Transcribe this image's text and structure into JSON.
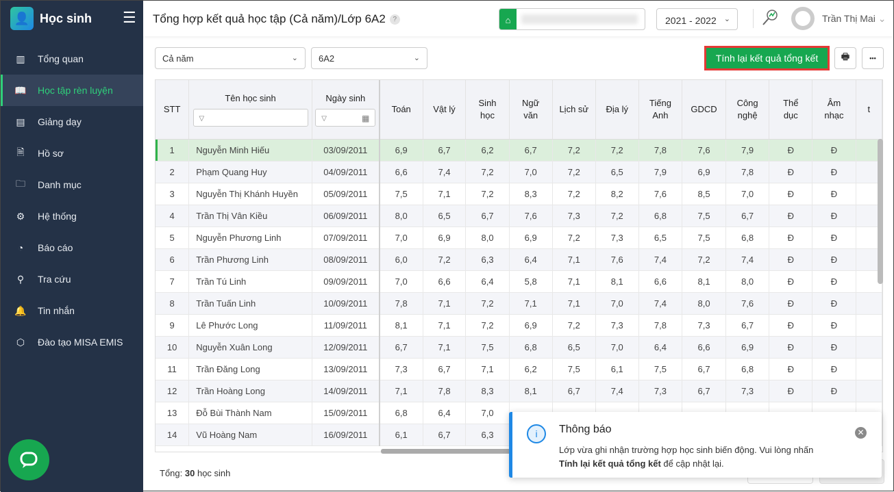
{
  "app": {
    "title": "Học sinh"
  },
  "sidebar": {
    "items": [
      {
        "label": "Tổng quan",
        "icon": "chart-bars-icon"
      },
      {
        "label": "Học tập rèn luyện",
        "icon": "book-icon",
        "active": true
      },
      {
        "label": "Giảng dạy",
        "icon": "board-icon"
      },
      {
        "label": "Hồ sơ",
        "icon": "document-icon"
      },
      {
        "label": "Danh mục",
        "icon": "folder-icon"
      },
      {
        "label": "Hệ thống",
        "icon": "gear-icon"
      },
      {
        "label": "Báo cáo",
        "icon": "pie-chart-icon"
      },
      {
        "label": "Tra cứu",
        "icon": "search-icon"
      },
      {
        "label": "Tin nhắn",
        "icon": "bell-icon"
      },
      {
        "label": "Đào tạo MISA EMIS",
        "icon": "box-icon"
      }
    ]
  },
  "header": {
    "title": "Tổng hợp kết quả học tập (Cả năm)/Lớp 6A2",
    "help": "?",
    "school_year": "2021 - 2022",
    "user": "Trần Thị Mai"
  },
  "toolbar": {
    "period": "Cả năm",
    "class": "6A2",
    "recalc_label": "Tính lại kết quả tổng kết",
    "more": "•••"
  },
  "table": {
    "headers": {
      "stt": "STT",
      "name": "Tên học sinh",
      "dob": "Ngày sinh"
    },
    "subjects": [
      [
        "Toán"
      ],
      [
        "Vật lý"
      ],
      [
        "Sinh",
        "học"
      ],
      [
        "Ngữ",
        "văn"
      ],
      [
        "Lịch sử"
      ],
      [
        "Địa lý"
      ],
      [
        "Tiếng",
        "Anh"
      ],
      [
        "GDCD"
      ],
      [
        "Công",
        "nghệ"
      ],
      [
        "Thể",
        "dục"
      ],
      [
        "Âm",
        "nhạc"
      ],
      [
        "t"
      ]
    ],
    "rows": [
      [
        "1",
        "Nguyễn Minh Hiếu",
        "03/09/2011",
        "6,9",
        "6,7",
        "6,2",
        "6,7",
        "7,2",
        "7,2",
        "7,8",
        "7,6",
        "7,9",
        "Đ",
        "Đ"
      ],
      [
        "2",
        "Phạm Quang Huy",
        "04/09/2011",
        "6,6",
        "7,4",
        "7,2",
        "7,0",
        "7,2",
        "6,5",
        "7,9",
        "6,9",
        "7,8",
        "Đ",
        "Đ"
      ],
      [
        "3",
        "Nguyễn Thị Khánh Huyền",
        "05/09/2011",
        "7,5",
        "7,1",
        "7,2",
        "8,3",
        "7,2",
        "8,2",
        "7,6",
        "8,5",
        "7,0",
        "Đ",
        "Đ"
      ],
      [
        "4",
        "Trần Thị Vân Kiều",
        "06/09/2011",
        "8,0",
        "6,5",
        "6,7",
        "7,6",
        "7,3",
        "7,2",
        "6,8",
        "7,5",
        "6,7",
        "Đ",
        "Đ"
      ],
      [
        "5",
        "Nguyễn Phương Linh",
        "07/09/2011",
        "7,0",
        "6,9",
        "8,0",
        "6,9",
        "7,2",
        "7,3",
        "6,5",
        "7,5",
        "6,8",
        "Đ",
        "Đ"
      ],
      [
        "6",
        "Trần Phương Linh",
        "08/09/2011",
        "6,0",
        "7,2",
        "6,3",
        "6,4",
        "7,1",
        "7,6",
        "7,4",
        "7,2",
        "7,4",
        "Đ",
        "Đ"
      ],
      [
        "7",
        "Trần Tú Linh",
        "09/09/2011",
        "7,0",
        "6,6",
        "6,4",
        "5,8",
        "7,1",
        "8,1",
        "6,6",
        "8,1",
        "8,0",
        "Đ",
        "Đ"
      ],
      [
        "8",
        "Trần Tuấn Linh",
        "10/09/2011",
        "7,8",
        "7,1",
        "7,2",
        "7,1",
        "7,1",
        "7,0",
        "7,4",
        "8,0",
        "7,6",
        "Đ",
        "Đ"
      ],
      [
        "9",
        "Lê Phước Long",
        "11/09/2011",
        "8,1",
        "7,1",
        "7,2",
        "6,9",
        "7,2",
        "7,3",
        "7,8",
        "7,3",
        "6,7",
        "Đ",
        "Đ"
      ],
      [
        "10",
        "Nguyễn Xuân Long",
        "12/09/2011",
        "6,7",
        "7,1",
        "7,5",
        "6,8",
        "6,5",
        "7,0",
        "6,4",
        "6,6",
        "6,9",
        "Đ",
        "Đ"
      ],
      [
        "11",
        "Trần Đăng Long",
        "13/09/2011",
        "7,3",
        "6,7",
        "7,1",
        "6,2",
        "7,5",
        "6,1",
        "7,5",
        "6,7",
        "6,8",
        "Đ",
        "Đ"
      ],
      [
        "12",
        "Trần Hoàng Long",
        "14/09/2011",
        "7,1",
        "7,8",
        "8,3",
        "8,1",
        "6,7",
        "7,4",
        "7,3",
        "6,7",
        "7,3",
        "Đ",
        "Đ"
      ],
      [
        "13",
        "Đỗ Bùi Thành Nam",
        "15/09/2011",
        "6,8",
        "6,4",
        "7,0",
        "",
        "",
        "",
        "",
        "",
        "",
        "",
        ""
      ],
      [
        "14",
        "Vũ Hoàng Nam",
        "16/09/2011",
        "6,1",
        "6,7",
        "6,3",
        "",
        "",
        "",
        "",
        "",
        "",
        "",
        ""
      ]
    ]
  },
  "footer": {
    "total_label": "Tổng:",
    "total_count": "30",
    "total_suffix": "học sinh"
  },
  "toast": {
    "title": "Thông báo",
    "message": "Lớp vừa ghi nhận trường hợp học sinh biến động. Vui lòng nhấn",
    "action": "Tính lại kết quả tổng kết",
    "suffix": "để cập nhật lại."
  }
}
